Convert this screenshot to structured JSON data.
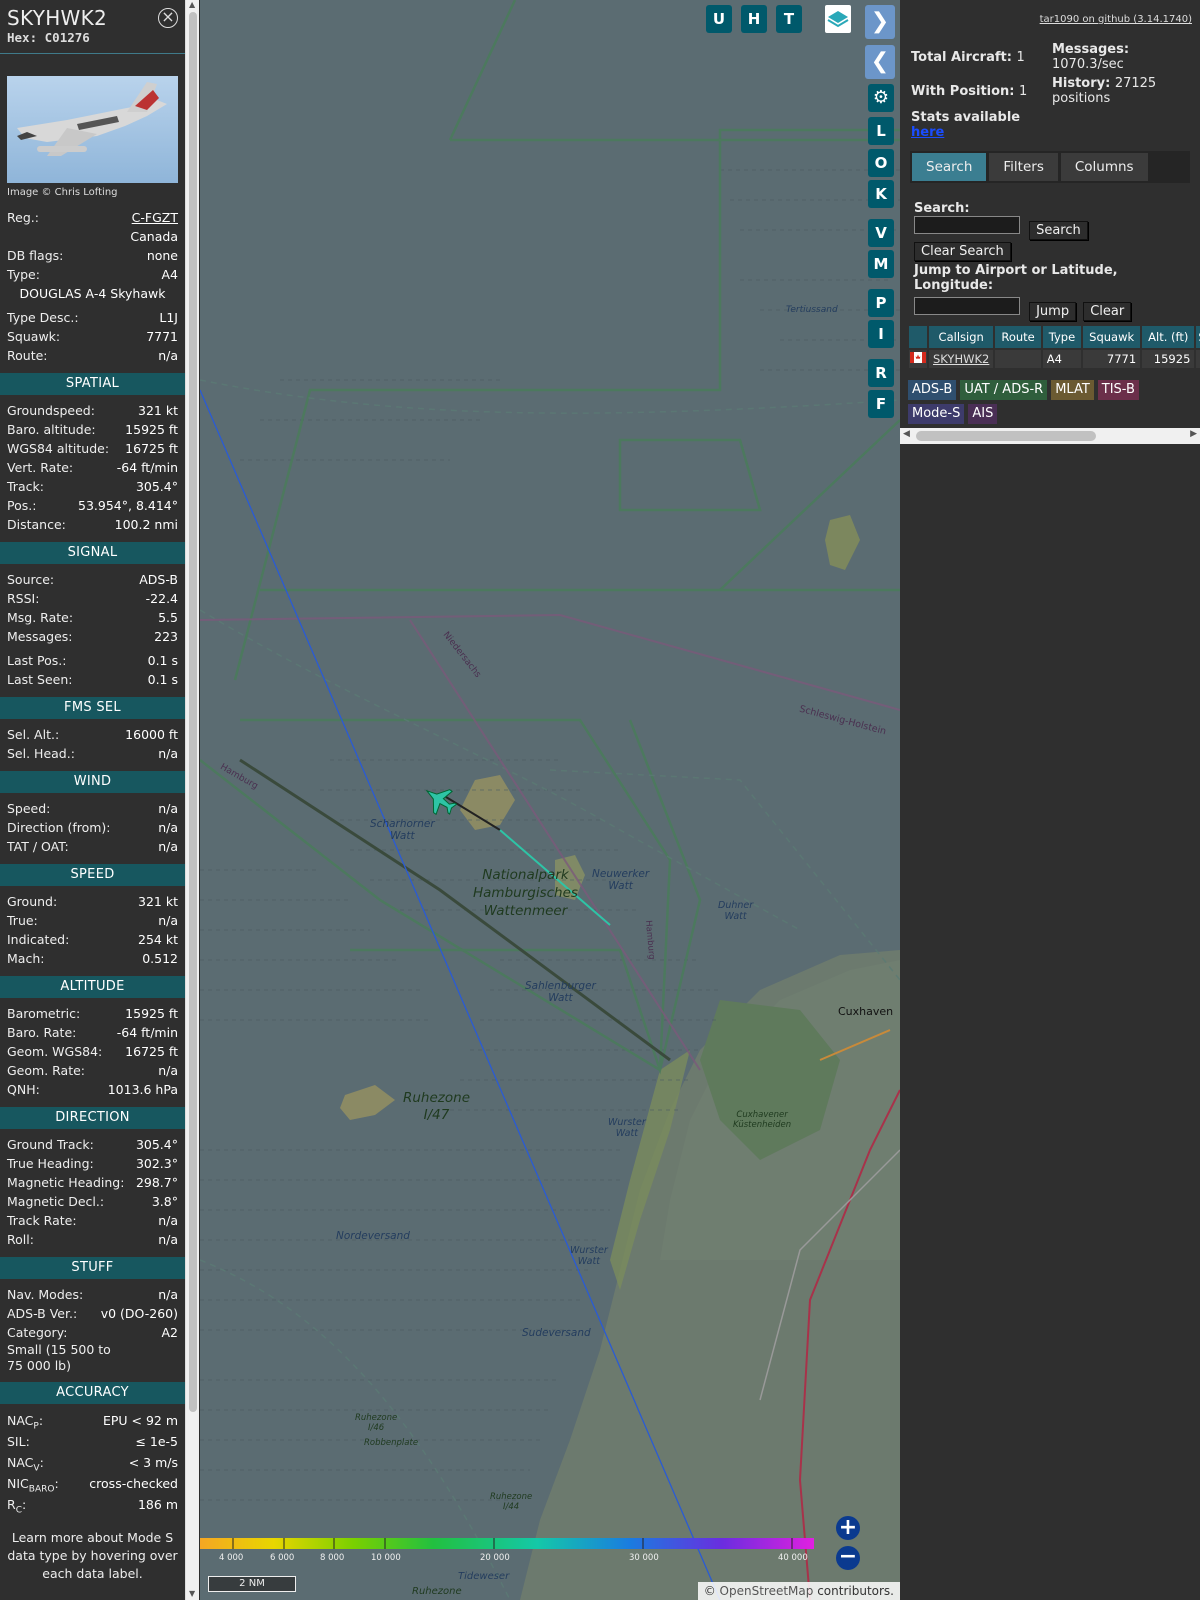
{
  "info": {
    "callsign": "SKYHWK2",
    "hex_label": "Hex:",
    "hex": "C01276",
    "photo_credit": "Image © Chris Lofting",
    "reg_label": "Reg.:",
    "reg": "C-FGZT",
    "country": "Canada",
    "dbflags_label": "DB flags:",
    "dbflags": "none",
    "type_label": "Type:",
    "type": "A4",
    "type_full": "DOUGLAS A-4 Skyhawk",
    "typedesc_label": "Type Desc.:",
    "typedesc": "L1J",
    "squawk_label": "Squawk:",
    "squawk": "7771",
    "route_label": "Route:",
    "route": "n/a",
    "sections": {
      "spatial": "SPATIAL",
      "signal": "SIGNAL",
      "fms": "FMS SEL",
      "wind": "WIND",
      "speed": "SPEED",
      "altitude": "ALTITUDE",
      "direction": "DIRECTION",
      "stuff": "STUFF",
      "accuracy": "ACCURACY"
    },
    "spatial": [
      {
        "k": "Groundspeed:",
        "v": "321 kt"
      },
      {
        "k": "Baro. altitude:",
        "v": "15925 ft"
      },
      {
        "k": "WGS84 altitude:",
        "v": "16725 ft"
      },
      {
        "k": "Vert. Rate:",
        "v": "-64 ft/min"
      },
      {
        "k": "Track:",
        "v": "305.4°"
      },
      {
        "k": "Pos.:",
        "v": "53.954°, 8.414°"
      },
      {
        "k": "Distance:",
        "v": "100.2 nmi"
      }
    ],
    "signal": [
      {
        "k": "Source:",
        "v": "ADS-B"
      },
      {
        "k": "RSSI:",
        "v": "-22.4"
      },
      {
        "k": "Msg. Rate:",
        "v": "5.5"
      },
      {
        "k": "Messages:",
        "v": "223"
      },
      {
        "k": "Last Pos.:",
        "v": "0.1 s"
      },
      {
        "k": "Last Seen:",
        "v": "0.1 s"
      }
    ],
    "fms": [
      {
        "k": "Sel. Alt.:",
        "v": "16000 ft"
      },
      {
        "k": "Sel. Head.:",
        "v": "n/a"
      }
    ],
    "wind": [
      {
        "k": "Speed:",
        "v": "n/a"
      },
      {
        "k": "Direction (from):",
        "v": "n/a"
      },
      {
        "k": "TAT / OAT:",
        "v": "n/a"
      }
    ],
    "speed": [
      {
        "k": "Ground:",
        "v": "321 kt"
      },
      {
        "k": "True:",
        "v": "n/a"
      },
      {
        "k": "Indicated:",
        "v": "254 kt"
      },
      {
        "k": "Mach:",
        "v": "0.512"
      }
    ],
    "altitude": [
      {
        "k": "Barometric:",
        "v": "15925 ft"
      },
      {
        "k": "Baro. Rate:",
        "v": "-64 ft/min"
      },
      {
        "k": "Geom. WGS84:",
        "v": "16725 ft"
      },
      {
        "k": "Geom. Rate:",
        "v": "n/a"
      },
      {
        "k": "QNH:",
        "v": "1013.6 hPa"
      }
    ],
    "direction": [
      {
        "k": "Ground Track:",
        "v": "305.4°"
      },
      {
        "k": "True Heading:",
        "v": "302.3°"
      },
      {
        "k": "Magnetic Heading:",
        "v": "298.7°"
      },
      {
        "k": "Magnetic Decl.:",
        "v": "3.8°"
      },
      {
        "k": "Track Rate:",
        "v": "n/a"
      },
      {
        "k": "Roll:",
        "v": "n/a"
      }
    ],
    "stuff": [
      {
        "k": "Nav. Modes:",
        "v": "n/a"
      },
      {
        "k": "ADS-B Ver.:",
        "v": "v0 (DO-260)"
      },
      {
        "k": "Category:",
        "v": "A2"
      }
    ],
    "category_desc_1": "Small (15 500 to",
    "category_desc_2": "75 000 lb)",
    "accuracy": [
      {
        "k": "NAC",
        "sub": "P",
        "v": "EPU < 92 m"
      },
      {
        "k": "SIL:",
        "sub": "",
        "v": "≤ 1e-5"
      },
      {
        "k": "NAC",
        "sub": "V",
        "v": "< 3 m/s"
      },
      {
        "k": "NIC",
        "sub": "BARO",
        "v": "cross-checked"
      },
      {
        "k": "R",
        "sub": "C",
        "v": "186 m"
      }
    ],
    "footnote": "Learn more about Mode S data type by hovering over each data label."
  },
  "map": {
    "buttons": [
      "U",
      "H",
      "T",
      "L",
      "O",
      "K",
      "V",
      "M",
      "P",
      "I",
      "R",
      "F"
    ],
    "labels": {
      "nationalpark_1": "Nationalpark",
      "nationalpark_2": "Hamburgisches",
      "nationalpark_3": "Wattenmeer",
      "scharhorner_1": "Scharhorner",
      "scharhorner_2": "Watt",
      "neuwerker_1": "Neuwerker",
      "neuwerker_2": "Watt",
      "duhner_1": "Duhner",
      "duhner_2": "Watt",
      "sahlenburger_1": "Sahlenburger",
      "sahlenburger_2": "Watt",
      "ruhezone_1": "Ruhezone",
      "ruhezone_2": "I/47",
      "wurster1_1": "Wurster",
      "wurster1_2": "Watt",
      "wurster2_1": "Wurster",
      "wurster2_2": "Watt",
      "nordeversand": "Nordeversand",
      "sudeversand": "Sudeversand",
      "cuxhaven": "Cuxhaven",
      "kustenheiden_1": "Cuxhavener",
      "kustenheiden_2": "Küstenheiden",
      "tertiussand": "Tertiussand",
      "niedersachs": "Niedersachs",
      "schleswig": "Schleswig-Holstein",
      "hamburg_1": "Hamburg",
      "hamburg_2": "Hamburg",
      "ruhezone146_1": "Ruhezone",
      "ruhezone146_2": "I/46",
      "robbenplate": "Robbenplate",
      "ruhezone144_1": "Ruhezone",
      "ruhezone144_2": "I/44",
      "tideweser": "Tideweser",
      "ruhezone_bottom": "Ruhezone"
    },
    "altitude_scale": [
      "4 000",
      "6 000",
      "8 000",
      "10 000",
      "20 000",
      "30 000",
      "40 000"
    ],
    "scale_bar": "2 NM",
    "attribution_prefix": "© ",
    "attribution_link": "OpenStreetMap",
    "attribution_suffix": " contributors."
  },
  "panel": {
    "github": "tar1090 on github (3.14.1740)",
    "total_label": "Total Aircraft:",
    "total": "1",
    "withpos_label": "With Position:",
    "withpos": "1",
    "messages_label": "Messages:",
    "messages": "1070.3/sec",
    "history_label": "History:",
    "history": "27125 positions",
    "stats_label": "Stats available",
    "stats_link": "here",
    "tabs": [
      "Search",
      "Filters",
      "Columns"
    ],
    "search_label": "Search:",
    "search_button": "Search",
    "clear_search_button": "Clear Search",
    "jump_label": "Jump to Airport or Latitude, Longitude:",
    "jump_button": "Jump",
    "clear_button": "Clear",
    "columns": [
      "Callsign",
      "Route",
      "Type",
      "Squawk",
      "Alt. (ft)",
      "Sp"
    ],
    "rows": [
      {
        "callsign": "SKYHWK2",
        "route": "",
        "type": "A4",
        "squawk": "7771",
        "alt": "15925"
      }
    ],
    "badges": [
      {
        "label": "ADS-B",
        "color": "#2f4f6f"
      },
      {
        "label": "UAT / ADS-R",
        "color": "#2f5e3c"
      },
      {
        "label": "MLAT",
        "color": "#6b5a32"
      },
      {
        "label": "TIS-B",
        "color": "#6b2f4a"
      },
      {
        "label": "Mode-S",
        "color": "#3d3b6b"
      },
      {
        "label": "AIS",
        "color": "#4a2f55"
      }
    ]
  },
  "colors": {
    "accent": "#17575f",
    "aircraft": "#2ec4a6"
  }
}
